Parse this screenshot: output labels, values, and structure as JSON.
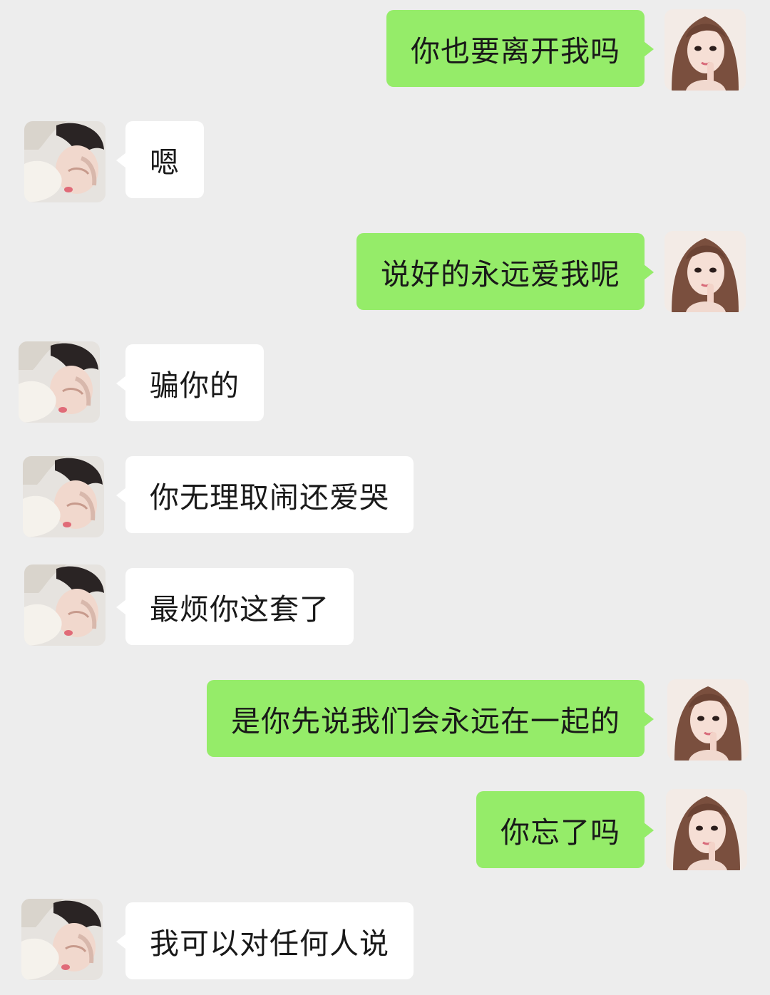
{
  "messages": [
    {
      "side": "out",
      "text": "你也要离开我吗"
    },
    {
      "side": "in",
      "text": "嗯"
    },
    {
      "side": "out",
      "text": "说好的永远爱我呢"
    },
    {
      "side": "in",
      "text": "骗你的"
    },
    {
      "side": "in",
      "text": "你无理取闹还爱哭"
    },
    {
      "side": "in",
      "text": "最烦你这套了"
    },
    {
      "side": "out",
      "text": "是你先说我们会永远在一起的"
    },
    {
      "side": "out",
      "text": "你忘了吗"
    },
    {
      "side": "in",
      "text": "我可以对任何人说"
    }
  ],
  "colors": {
    "background": "#ededed",
    "outgoing_bubble": "#95ec69",
    "incoming_bubble": "#ffffff",
    "text": "#191919"
  },
  "avatars": {
    "me": "girl-avatar-icon",
    "other": "boy-avatar-icon"
  }
}
